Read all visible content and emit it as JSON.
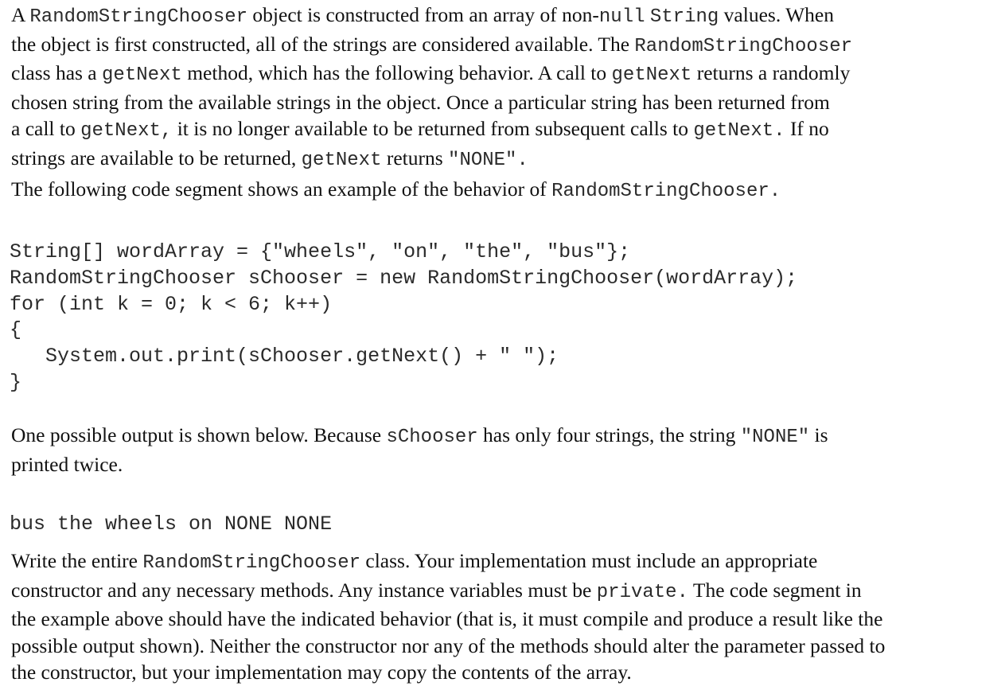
{
  "intro": {
    "lines": [
      [
        {
          "t": "A "
        },
        {
          "c": "RandomStringChooser"
        },
        {
          "t": " object is constructed from an array of non-"
        },
        {
          "c": "null"
        },
        {
          "t": " "
        },
        {
          "c": "String"
        },
        {
          "t": " values. When"
        }
      ],
      [
        {
          "t": "the object is first constructed, all of the strings are considered available. The "
        },
        {
          "c": "RandomStringChooser"
        }
      ],
      [
        {
          "t": "class has a "
        },
        {
          "c": "getNext"
        },
        {
          "t": " method, which has the following behavior. A call to "
        },
        {
          "c": "getNext"
        },
        {
          "t": " returns a randomly"
        }
      ],
      [
        {
          "t": "chosen string from the available strings in the object. Once a particular string has been returned from"
        }
      ],
      [
        {
          "t": "a call to "
        },
        {
          "c": "getNext,"
        },
        {
          "t": " it is no longer available to be returned from subsequent calls to "
        },
        {
          "c": "getNext."
        },
        {
          "t": " If no"
        }
      ],
      [
        {
          "t": "strings are available to be returned, "
        },
        {
          "c": "getNext"
        },
        {
          "t": " returns "
        },
        {
          "c": "\"NONE\"."
        }
      ]
    ]
  },
  "example_intro": {
    "lines": [
      [
        {
          "t": "The following code segment shows an example of the behavior of "
        },
        {
          "c": "RandomStringChooser."
        }
      ]
    ]
  },
  "code_segment": [
    "String[] wordArray = {\"wheels\", \"on\", \"the\", \"bus\"};",
    "RandomStringChooser sChooser = new RandomStringChooser(wordArray);",
    "for (int k = 0; k < 6; k++)",
    "{",
    "   System.out.print(sChooser.getNext() + \" \");",
    "}"
  ],
  "output_intro": {
    "lines": [
      [
        {
          "t": "One possible output is shown below. Because "
        },
        {
          "c": "sChooser"
        },
        {
          "t": " has only four strings, the string "
        },
        {
          "c": "\"NONE\""
        },
        {
          "t": " is"
        }
      ],
      [
        {
          "t": "printed twice."
        }
      ]
    ]
  },
  "sample_output": "bus the wheels on NONE NONE",
  "task": {
    "lines": [
      [
        {
          "t": "Write the entire "
        },
        {
          "c": "RandomStringChooser"
        },
        {
          "t": " class. Your implementation must include an appropriate"
        }
      ],
      [
        {
          "t": "constructor and any necessary methods. Any instance variables must be "
        },
        {
          "c": "private."
        },
        {
          "t": " The code segment in"
        }
      ],
      [
        {
          "t": "the example above should have the indicated behavior (that is, it must compile and produce a result like the"
        }
      ],
      [
        {
          "t": "possible output shown). Neither the constructor nor any of the methods should alter the parameter passed to"
        }
      ],
      [
        {
          "t": "the constructor, but your implementation may copy the contents of the array."
        }
      ]
    ]
  }
}
